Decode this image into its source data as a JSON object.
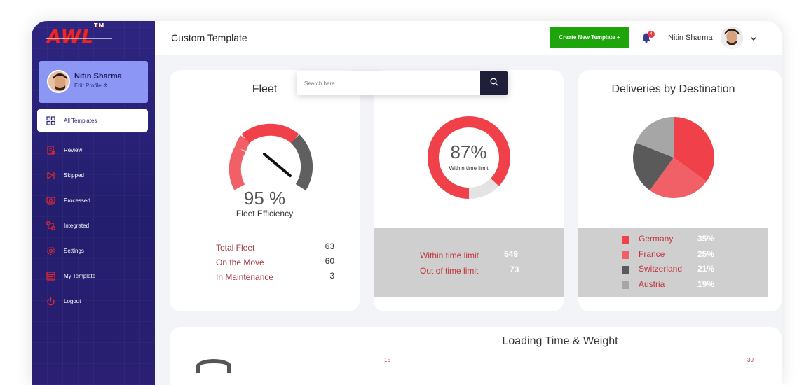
{
  "brand": {
    "logo": "AWL",
    "tm": "TM"
  },
  "profile": {
    "name": "Nitin Sharma",
    "edit": "Edit Profile ⚙"
  },
  "sidebar": {
    "items": [
      {
        "label": "All Templates",
        "icon": "grid-icon"
      },
      {
        "label": "Review",
        "icon": "review-icon"
      },
      {
        "label": "Skipped",
        "icon": "skip-icon"
      },
      {
        "label": "Processed",
        "icon": "processed-icon"
      },
      {
        "label": "Integrated",
        "icon": "integrated-icon"
      },
      {
        "label": "Settings",
        "icon": "gear-icon"
      },
      {
        "label": "My Template",
        "icon": "template-icon"
      },
      {
        "label": "Logout",
        "icon": "power-icon"
      }
    ]
  },
  "header": {
    "title": "Custom Template",
    "create_label": "Create New Template +",
    "notif_count": "4",
    "user_name": "Nitin Sharma"
  },
  "search": {
    "placeholder": "Search here"
  },
  "fleet": {
    "title": "Fleet",
    "gauge_value": "95 %",
    "gauge_label": "Fleet Efficiency",
    "gauge_fraction": 0.95,
    "stats": [
      {
        "label": "Total Fleet",
        "value": "63"
      },
      {
        "label": "On the Move",
        "value": "60"
      },
      {
        "label": "In Maintenance",
        "value": "3"
      }
    ]
  },
  "delivery": {
    "percent": "87%",
    "caption": "Within time limit",
    "fraction": 0.87,
    "stats": [
      {
        "label": "Within time limit",
        "value": "549"
      },
      {
        "label": "Out of time limit",
        "value": "73"
      }
    ]
  },
  "destination": {
    "title": "Deliveries by Destination",
    "items": [
      {
        "label": "Germany",
        "pct": "35%",
        "color": "#f0414b"
      },
      {
        "label": "France",
        "pct": "25%",
        "color": "#f16066"
      },
      {
        "label": "Switzerland",
        "pct": "21%",
        "color": "#5a5a5a"
      },
      {
        "label": "Austria",
        "pct": "19%",
        "color": "#a6a6a6"
      }
    ]
  },
  "loading": {
    "title": "Loading Time & Weight",
    "y_left": "15",
    "y_right": "30"
  },
  "colors": {
    "accent": "#1ea50b",
    "sidebar": "#2d2580",
    "red": "#f0414b"
  }
}
